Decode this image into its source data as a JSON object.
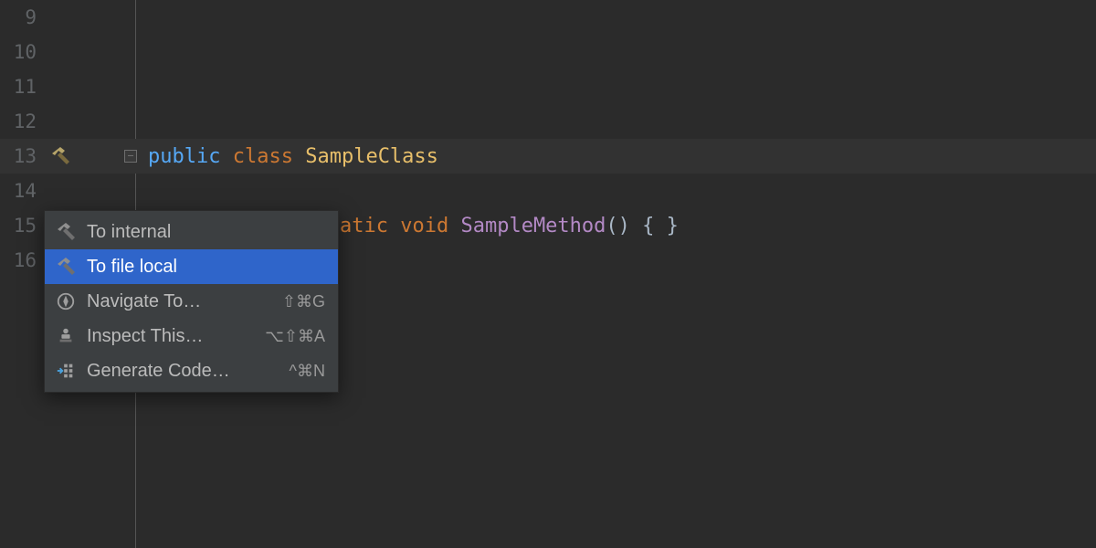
{
  "gutter": {
    "lines": [
      "9",
      "10",
      "11",
      "12",
      "13",
      "14",
      "15",
      "16"
    ]
  },
  "code": {
    "l13": {
      "w1": "public",
      "w2": "class",
      "w3": "SampleClass"
    },
    "l15": {
      "w2_partial": "atic",
      "w3": "void",
      "w4": "SampleMethod",
      "w5": "()",
      "w6": "{ }"
    }
  },
  "menu": {
    "items": [
      {
        "label": "To internal",
        "shortcut": ""
      },
      {
        "label": "To file local",
        "shortcut": ""
      },
      {
        "label": "Navigate To…",
        "shortcut": "⇧⌘G"
      },
      {
        "label": "Inspect This…",
        "shortcut": "⌥⇧⌘A"
      },
      {
        "label": "Generate Code…",
        "shortcut": "^⌘N"
      }
    ]
  }
}
